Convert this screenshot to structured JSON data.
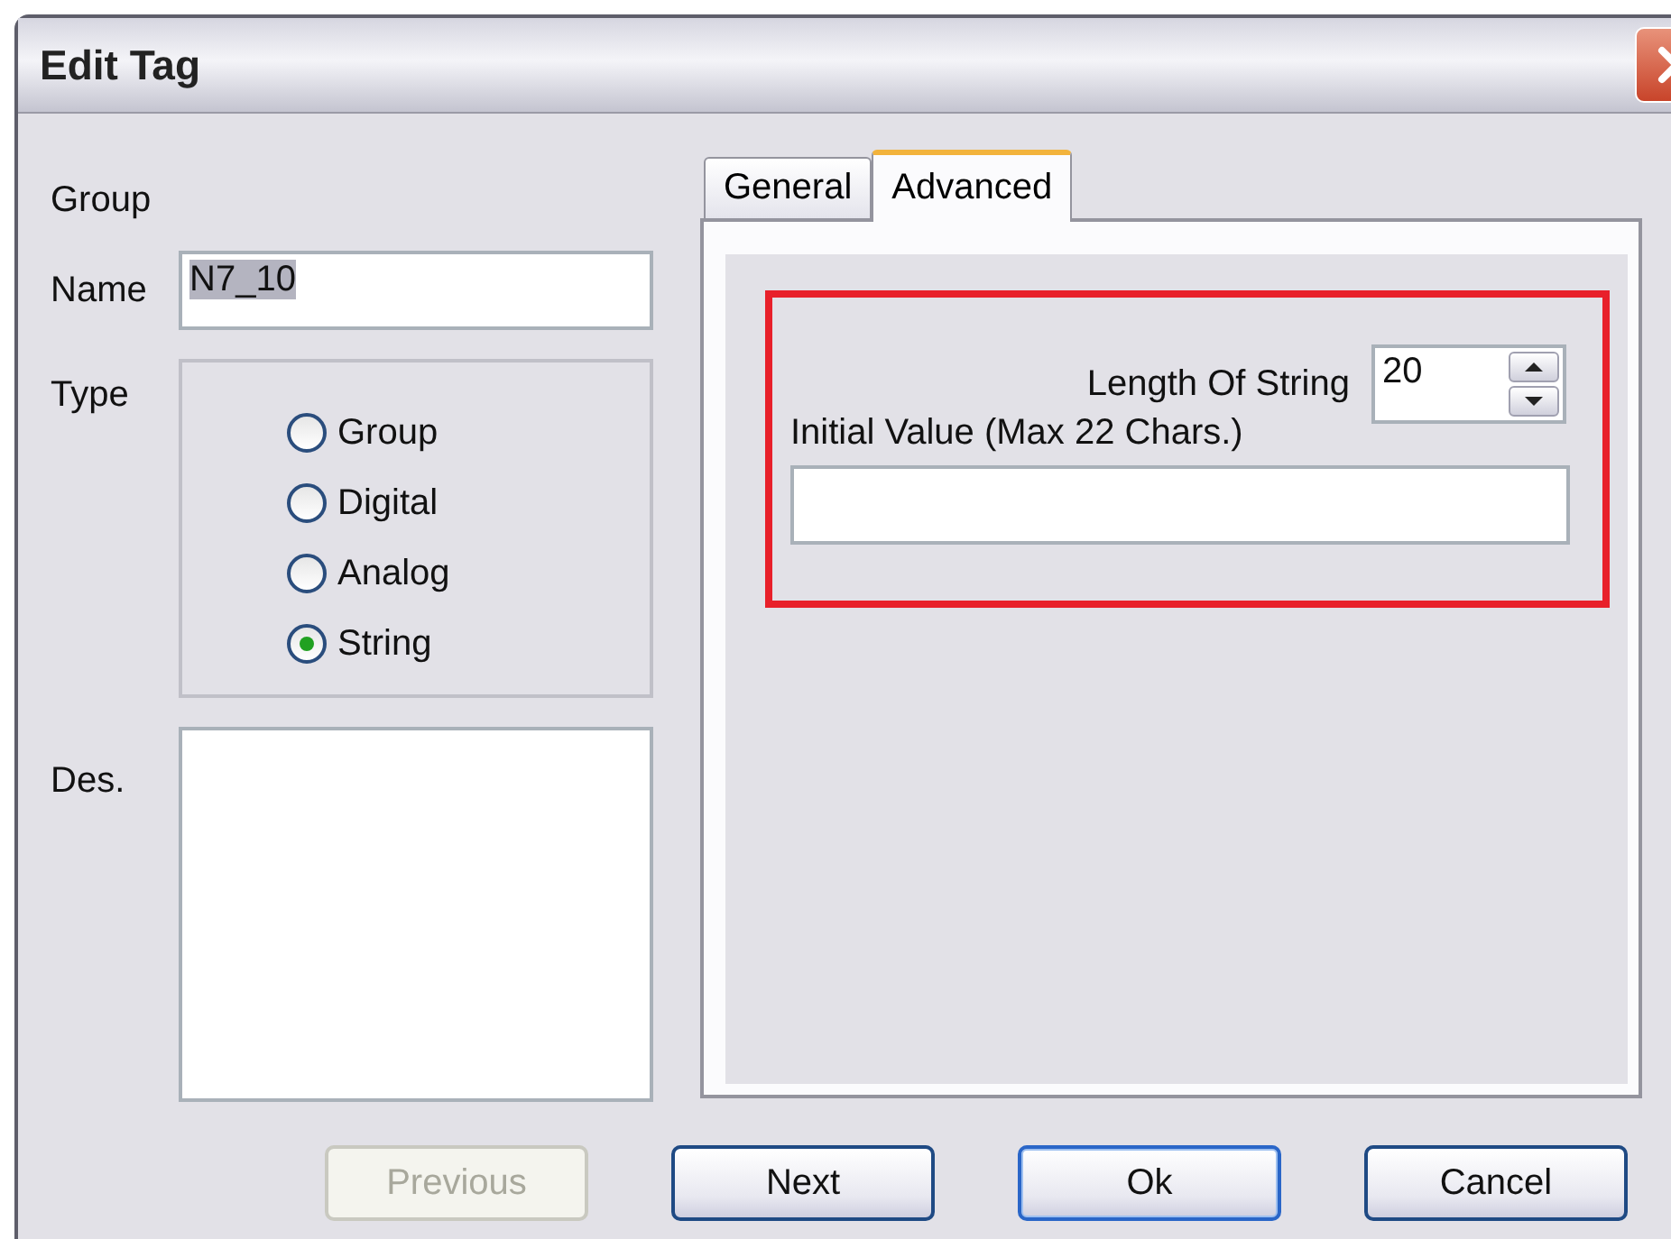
{
  "window": {
    "title": "Edit Tag"
  },
  "form": {
    "group_label": "Group",
    "name_label": "Name",
    "name_value": "N7_10",
    "name_value_selected": true,
    "type_label": "Type",
    "description_label": "Des.",
    "types": [
      {
        "label": "Group",
        "selected": false
      },
      {
        "label": "Digital",
        "selected": false
      },
      {
        "label": "Analog",
        "selected": false
      },
      {
        "label": "String",
        "selected": true
      }
    ]
  },
  "tabs": [
    {
      "label": "General",
      "selected": false
    },
    {
      "label": "Advanced",
      "selected": true
    }
  ],
  "advanced": {
    "length_label": "Length Of String",
    "length_value": "20",
    "initial_value_label": "Initial Value (Max 22 Chars.)"
  },
  "buttons": [
    {
      "label": "Previous",
      "disabled": true,
      "default": false
    },
    {
      "label": "Next",
      "disabled": false,
      "default": false
    },
    {
      "label": "Ok",
      "disabled": false,
      "default": true
    },
    {
      "label": "Cancel",
      "disabled": false,
      "default": false
    }
  ]
}
